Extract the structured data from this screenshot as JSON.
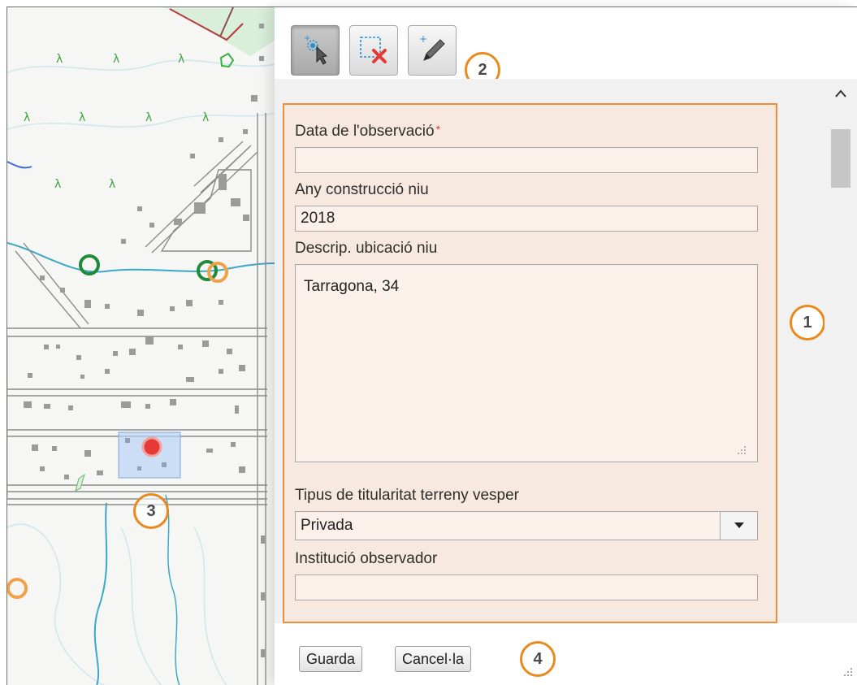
{
  "toolbar": {
    "select_tool": "select-feature-icon",
    "delete_tool": "delete-selection-icon",
    "edit_tool": "edit-pencil-icon"
  },
  "form": {
    "fields": [
      {
        "label": "Data de l'observació",
        "required": true,
        "value": ""
      },
      {
        "label": "Any construcció niu",
        "value": "2018"
      },
      {
        "label": "Descrip. ubicació niu",
        "value": "Tarragona, 34"
      },
      {
        "label": "Tipus de titularitat terreny vesper",
        "value": "Privada"
      },
      {
        "label": "Institució observador",
        "value": ""
      }
    ],
    "required_marker": "*"
  },
  "actions": {
    "save_label": "Guarda",
    "cancel_label": "Cancel·la"
  },
  "callouts": [
    "1",
    "2",
    "3",
    "4"
  ],
  "colors": {
    "accent_orange": "#f08c3a",
    "form_bg": "#f7e9df",
    "selected_point": "#e53935",
    "map_point_green": "#1f8a3a",
    "map_point_orange": "#f0a14a"
  }
}
